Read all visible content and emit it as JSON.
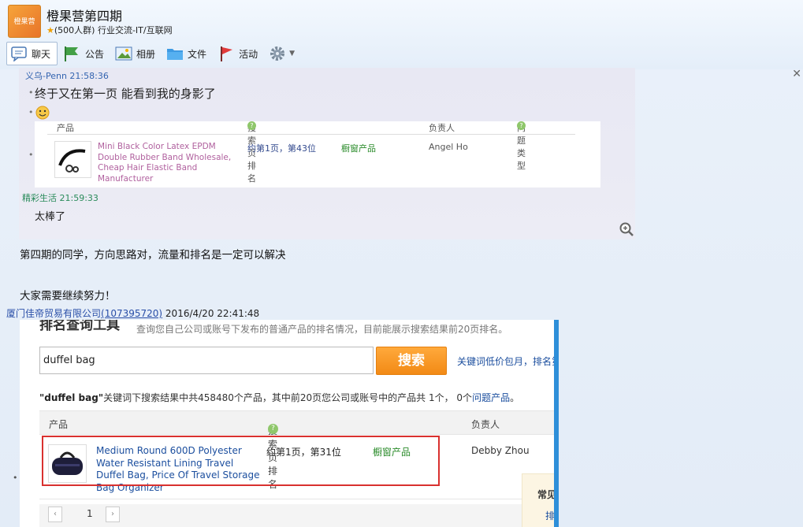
{
  "group": {
    "title": "橙果营第四期",
    "subtitle": "(500人群) 行业交流-IT/互联网",
    "logo_text": "橙果营"
  },
  "tabs": [
    {
      "label": "聊天",
      "icon": "chat-icon"
    },
    {
      "label": "公告",
      "icon": "flag-icon"
    },
    {
      "label": "相册",
      "icon": "image-icon"
    },
    {
      "label": "文件",
      "icon": "folder-icon"
    },
    {
      "label": "活动",
      "icon": "event-flag-icon"
    }
  ],
  "shot1": {
    "sender": "义乌-Penn  21:58:36",
    "message": "终于又在第一页 能看到我的身影了",
    "table_headers": [
      "产品",
      "搜索页排名",
      "负责人",
      "问题类型"
    ],
    "product_name": "Mini Black Color Latex EPDM Double Rubber Band Wholesale, Cheap Hair Elastic Band Manufacturer",
    "rank": "约第1页，第43位",
    "type": "橱窗产品",
    "owner": "Angel Ho",
    "sender2": "精彩生活  21:59:33",
    "message2": "太棒了"
  },
  "chat": {
    "line1": "第四期的同学，方向思路对，流量和排名是一定可以解决",
    "line2": "大家需要继续努力！"
  },
  "sender2": {
    "company": "厦门佳帝贸易有限公司",
    "qq": "(107395720)",
    "time": "2016/4/20 22:41:48"
  },
  "shot2": {
    "title": "排名查询工具",
    "desc": "查询您自己公司或账号下发布的普通产品的排名情况，目前能展示搜索结果前20页排名。",
    "search_value": "duffel bag",
    "search_button": "搜索",
    "promo_link": "关键词低价包月，排名第",
    "summary_keyword": "\"duffel bag\"",
    "summary_text": "关键词下搜索结果中共458480个产品，其中前20页您公司或账号中的产品共 1个，  0个",
    "summary_link": "问题产品",
    "summary_end": "。",
    "table_headers": [
      "产品",
      "搜索页排名",
      "负责人"
    ],
    "product_name": "Medium Round 600D Polyester Water Resistant Lining Travel Duffel Bag, Price Of Travel Storage Bag Organizer",
    "rank": "约第1页，第31位",
    "type": "橱窗产品",
    "owner": "Debby Zhou",
    "page": "1",
    "side_label": "常见",
    "side_link": "排"
  }
}
